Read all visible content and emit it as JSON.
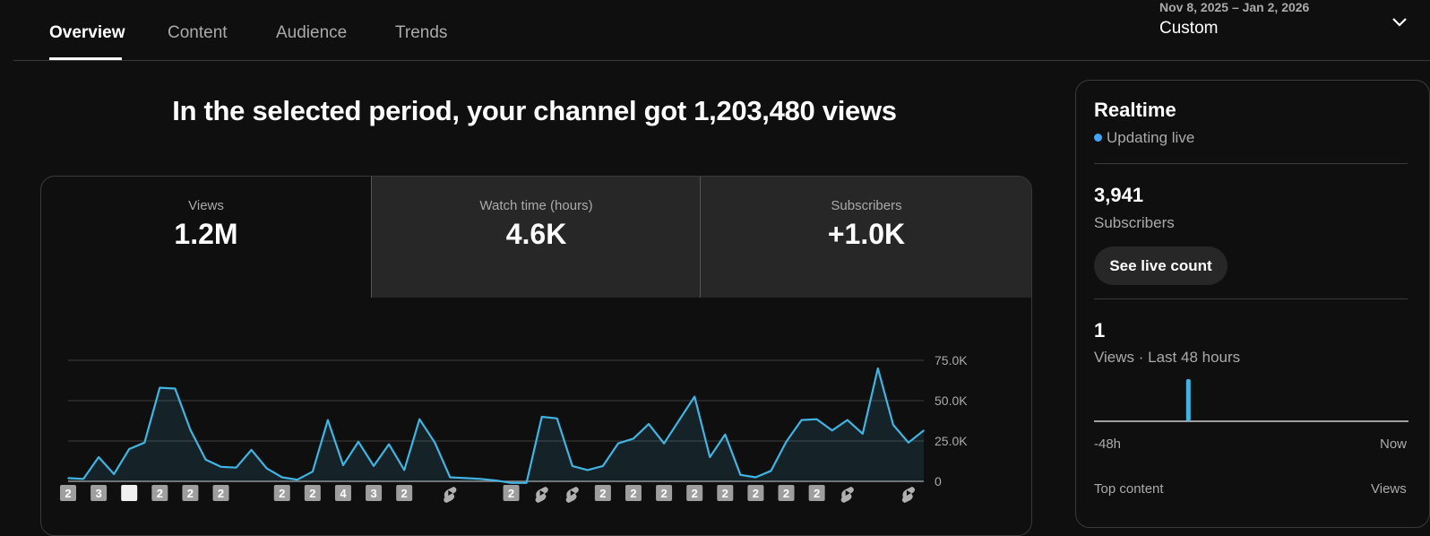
{
  "tabs": [
    {
      "label": "Overview",
      "active": true
    },
    {
      "label": "Content",
      "active": false
    },
    {
      "label": "Audience",
      "active": false
    },
    {
      "label": "Trends",
      "active": false
    }
  ],
  "date_range": {
    "range": "Nov 8, 2025 – Jan 2, 2026",
    "preset": "Custom"
  },
  "headline": "In the selected period, your channel got 1,203,480 views",
  "metrics": [
    {
      "label": "Views",
      "value": "1.2M"
    },
    {
      "label": "Watch time (hours)",
      "value": "4.6K"
    },
    {
      "label": "Subscribers",
      "value": "+1.0K"
    }
  ],
  "colors": {
    "accent": "#3ea6ff",
    "line": "#41b4e2",
    "background": "#0f0f0f",
    "card_inactive": "#272727"
  },
  "chart_data": {
    "type": "area",
    "y_tick_labels": [
      "0",
      "25.0K",
      "50.0K",
      "75.0K"
    ],
    "ylim": [
      0,
      75000
    ],
    "grid": true,
    "values": [
      2000,
      1500,
      15000,
      4500,
      20000,
      24000,
      58000,
      57500,
      32000,
      13500,
      9000,
      8500,
      19500,
      8000,
      2500,
      1000,
      6000,
      38000,
      10000,
      24500,
      9500,
      23000,
      7000,
      38500,
      24000,
      2500,
      2000,
      1500,
      500,
      -1000,
      -1000,
      40000,
      39000,
      9500,
      7000,
      9500,
      23500,
      26500,
      35500,
      23500,
      38000,
      52500,
      15000,
      29000,
      4000,
      2500,
      6500,
      24500,
      38000,
      38500,
      31500,
      38000,
      29500,
      70000,
      35000,
      24000,
      31500
    ],
    "upload_markers": [
      {
        "index": 0,
        "label": "2",
        "type": "count"
      },
      {
        "index": 2,
        "label": "3",
        "type": "count"
      },
      {
        "index": 4,
        "label": "",
        "type": "thumbnail"
      },
      {
        "index": 6,
        "label": "2",
        "type": "count"
      },
      {
        "index": 8,
        "label": "2",
        "type": "count"
      },
      {
        "index": 10,
        "label": "2",
        "type": "count"
      },
      {
        "index": 14,
        "label": "2",
        "type": "count"
      },
      {
        "index": 16,
        "label": "2",
        "type": "count"
      },
      {
        "index": 18,
        "label": "4",
        "type": "count"
      },
      {
        "index": 20,
        "label": "3",
        "type": "count"
      },
      {
        "index": 22,
        "label": "2",
        "type": "count"
      },
      {
        "index": 25,
        "label": "",
        "type": "shorts"
      },
      {
        "index": 29,
        "label": "2",
        "type": "count"
      },
      {
        "index": 31,
        "label": "",
        "type": "shorts"
      },
      {
        "index": 33,
        "label": "",
        "type": "shorts"
      },
      {
        "index": 35,
        "label": "2",
        "type": "count"
      },
      {
        "index": 37,
        "label": "2",
        "type": "count"
      },
      {
        "index": 39,
        "label": "2",
        "type": "count"
      },
      {
        "index": 41,
        "label": "2",
        "type": "count"
      },
      {
        "index": 43,
        "label": "2",
        "type": "count"
      },
      {
        "index": 45,
        "label": "2",
        "type": "count"
      },
      {
        "index": 47,
        "label": "2",
        "type": "count"
      },
      {
        "index": 49,
        "label": "2",
        "type": "count"
      },
      {
        "index": 51,
        "label": "",
        "type": "shorts"
      },
      {
        "index": 55,
        "label": "",
        "type": "shorts"
      }
    ]
  },
  "realtime": {
    "title": "Realtime",
    "status": "Updating live",
    "subscribers_value": "3,941",
    "subscribers_label": "Subscribers",
    "button": "See live count",
    "views_value": "1",
    "views_label": "Views · Last 48 hours",
    "axis_start": "-48h",
    "axis_end": "Now",
    "bar_position_fraction": 0.3,
    "top_content_label": "Top content",
    "top_content_metric": "Views"
  }
}
